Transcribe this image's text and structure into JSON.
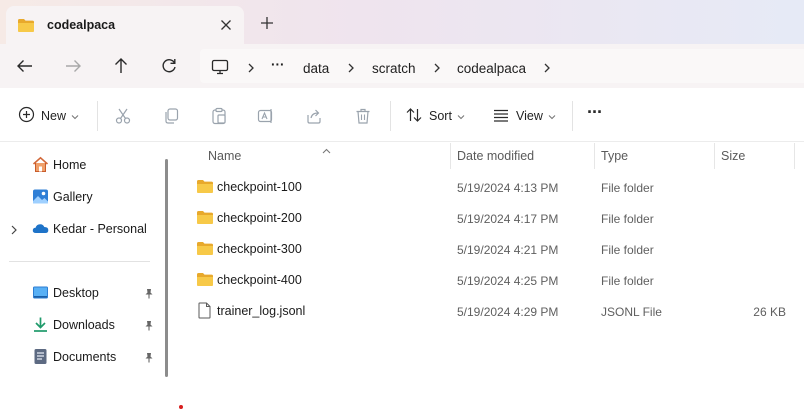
{
  "window": {
    "tab_title": "codealpaca"
  },
  "breadcrumb": {
    "overflow": "···",
    "items": [
      "data",
      "scratch",
      "codealpaca"
    ]
  },
  "toolbar": {
    "new_label": "New",
    "sort_label": "Sort",
    "view_label": "View",
    "more_label": "···"
  },
  "nav": {
    "items": [
      {
        "label": "Home",
        "icon": "home-icon"
      },
      {
        "label": "Gallery",
        "icon": "gallery-icon"
      },
      {
        "label": "Kedar - Personal",
        "icon": "onedrive-cloud-icon"
      },
      {
        "label": "Desktop",
        "icon": "desktop-folder-icon"
      },
      {
        "label": "Downloads",
        "icon": "downloads-icon"
      },
      {
        "label": "Documents",
        "icon": "documents-icon"
      }
    ]
  },
  "columns": {
    "name": "Name",
    "date": "Date modified",
    "type": "Type",
    "size": "Size"
  },
  "files": [
    {
      "name": "checkpoint-100",
      "date": "5/19/2024 4:13 PM",
      "type": "File folder",
      "size": "",
      "icon": "folder-icon"
    },
    {
      "name": "checkpoint-200",
      "date": "5/19/2024 4:17 PM",
      "type": "File folder",
      "size": "",
      "icon": "folder-icon"
    },
    {
      "name": "checkpoint-300",
      "date": "5/19/2024 4:21 PM",
      "type": "File folder",
      "size": "",
      "icon": "folder-icon"
    },
    {
      "name": "checkpoint-400",
      "date": "5/19/2024 4:25 PM",
      "type": "File folder",
      "size": "",
      "icon": "folder-icon"
    },
    {
      "name": "trainer_log.jsonl",
      "date": "5/19/2024 4:29 PM",
      "type": "JSONL File",
      "size": "26 KB",
      "icon": "file-icon"
    }
  ],
  "colors": {
    "folder_yellow": "#f3c13a",
    "accent_blue": "#1e73c8",
    "tabbar_gradient_left": "#f6eae6",
    "tabbar_gradient_right": "#e6eaf6"
  }
}
